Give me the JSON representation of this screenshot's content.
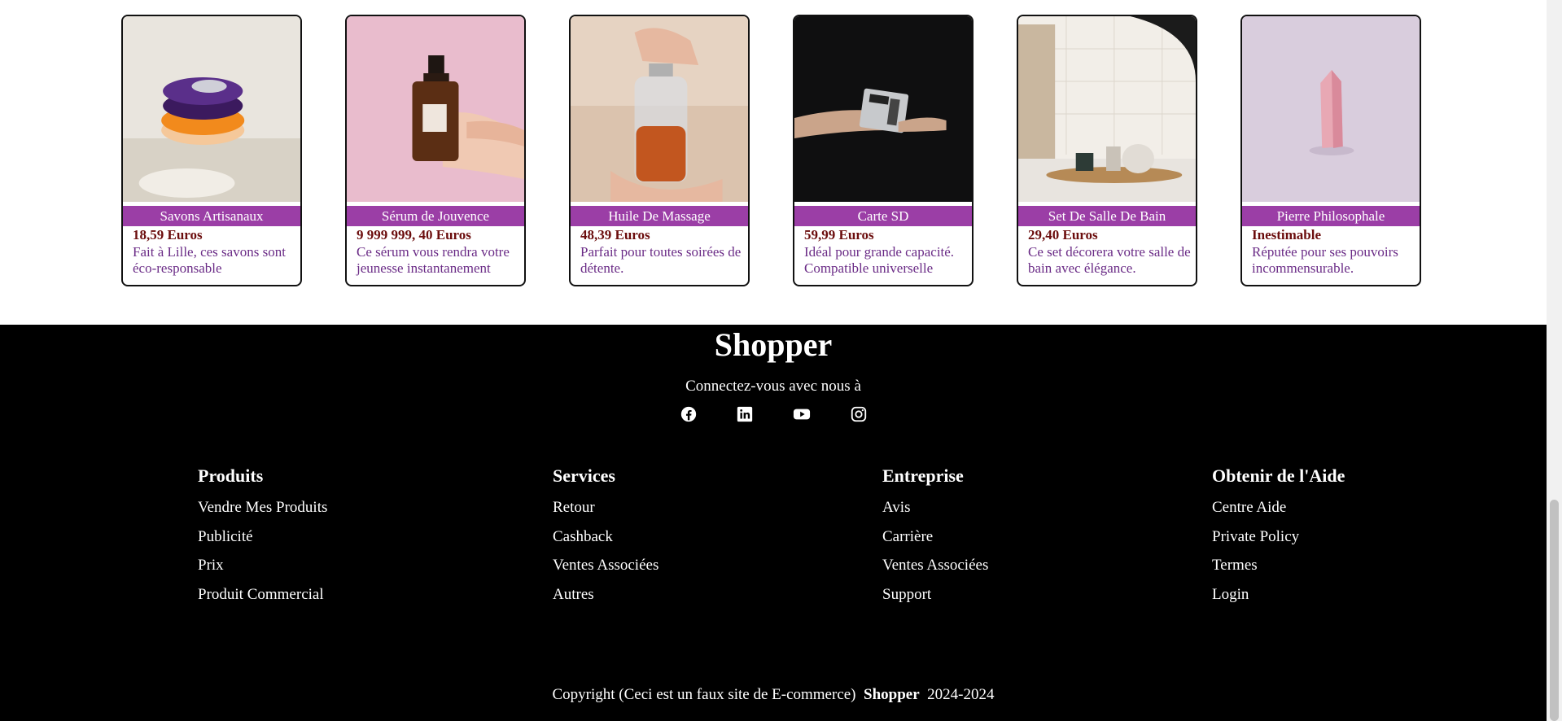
{
  "products": [
    {
      "name": "Savons Artisanaux",
      "price": "18,59 Euros",
      "desc": "Fait à Lille, ces savons sont éco-responsable",
      "image_icon": "soap-image"
    },
    {
      "name": "Sérum de Jouvence",
      "price": "9 999 999, 40 Euros",
      "desc": "Ce sérum vous rendra votre jeunesse instantanement",
      "image_icon": "serum-bottle-image"
    },
    {
      "name": "Huile De Massage",
      "price": "48,39 Euros",
      "desc": "Parfait pour toutes soirées de détente.",
      "image_icon": "oil-bottle-image"
    },
    {
      "name": "Carte SD",
      "price": "59,99 Euros",
      "desc": "Idéal pour grande capacité. Compatible universelle",
      "image_icon": "sd-card-image"
    },
    {
      "name": "Set De Salle De Bain",
      "price": "29,40 Euros",
      "desc": "Ce set décorera votre salle de bain avec élégance.",
      "image_icon": "bathroom-set-image"
    },
    {
      "name": "Pierre Philosophale",
      "price": "Inestimable",
      "desc": "Réputée pour ses pouvoirs incommensurable.",
      "image_icon": "crystal-image"
    }
  ],
  "footer": {
    "brand": "Shopper",
    "connect": "Connectez-vous avec nous à",
    "social": [
      "facebook-icon",
      "linkedin-icon",
      "youtube-icon",
      "instagram-icon"
    ],
    "columns": [
      {
        "title": "Produits",
        "links": [
          "Vendre Mes Produits",
          "Publicité",
          "Prix",
          "Produit Commercial"
        ]
      },
      {
        "title": "Services",
        "links": [
          "Retour",
          "Cashback",
          "Ventes Associées",
          "Autres"
        ]
      },
      {
        "title": "Entreprise",
        "links": [
          "Avis",
          "Carrière",
          "Ventes Associées",
          "Support"
        ]
      },
      {
        "title": "Obtenir de l'Aide",
        "links": [
          "Centre Aide",
          "Private Policy",
          "Termes",
          "Login"
        ]
      }
    ],
    "copyright_prefix": "Copyright (Ceci est un faux site de E-commerce)",
    "copyright_brand": "Shopper",
    "copyright_years": "2024-2024"
  },
  "colors": {
    "name_band": "#9b3ea6",
    "price": "#6b0d0d",
    "desc": "#6a2b86",
    "footer_bg": "#000000"
  }
}
